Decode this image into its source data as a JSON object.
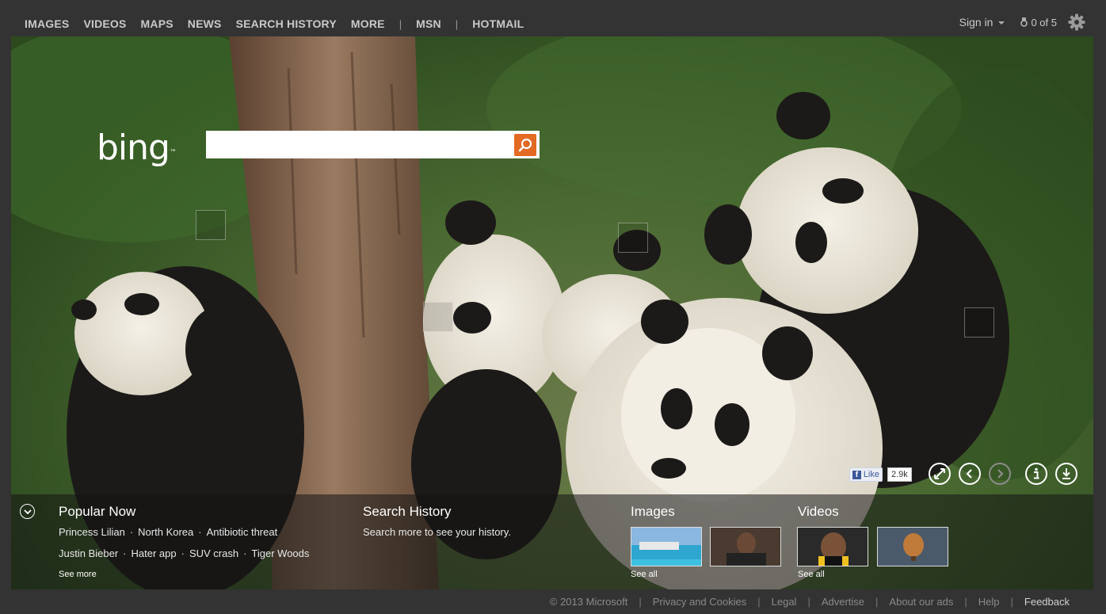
{
  "nav": {
    "items": [
      "IMAGES",
      "VIDEOS",
      "MAPS",
      "NEWS",
      "SEARCH HISTORY",
      "MORE"
    ],
    "sep1": "|",
    "msn": "MSN",
    "sep2": "|",
    "hotmail": "HOTMAIL"
  },
  "account": {
    "sign_in": "Sign in",
    "rewards": "0 of 5"
  },
  "logo": "bing",
  "search": {
    "value": "",
    "placeholder": ""
  },
  "social": {
    "like_label": "Like",
    "like_count": "2.9k"
  },
  "popular": {
    "title": "Popular Now",
    "row1": [
      "Princess Lilian",
      "North Korea",
      "Antibiotic threat"
    ],
    "row2": [
      "Justin Bieber",
      "Hater app",
      "SUV crash",
      "Tiger Woods"
    ],
    "see_more": "See more"
  },
  "history": {
    "title": "Search History",
    "text": "Search more to see your history."
  },
  "images": {
    "title": "Images",
    "see_all": "See all"
  },
  "videos": {
    "title": "Videos",
    "see_all": "See all"
  },
  "footer": {
    "items": [
      "© 2013 Microsoft",
      "Privacy and Cookies",
      "Legal",
      "Advertise",
      "About our ads",
      "Help",
      "Feedback"
    ]
  },
  "colors": {
    "background": "#333333",
    "search_button": "#e36a23",
    "nav_text": "#c9c9c9",
    "facebook": "#3b5998"
  }
}
